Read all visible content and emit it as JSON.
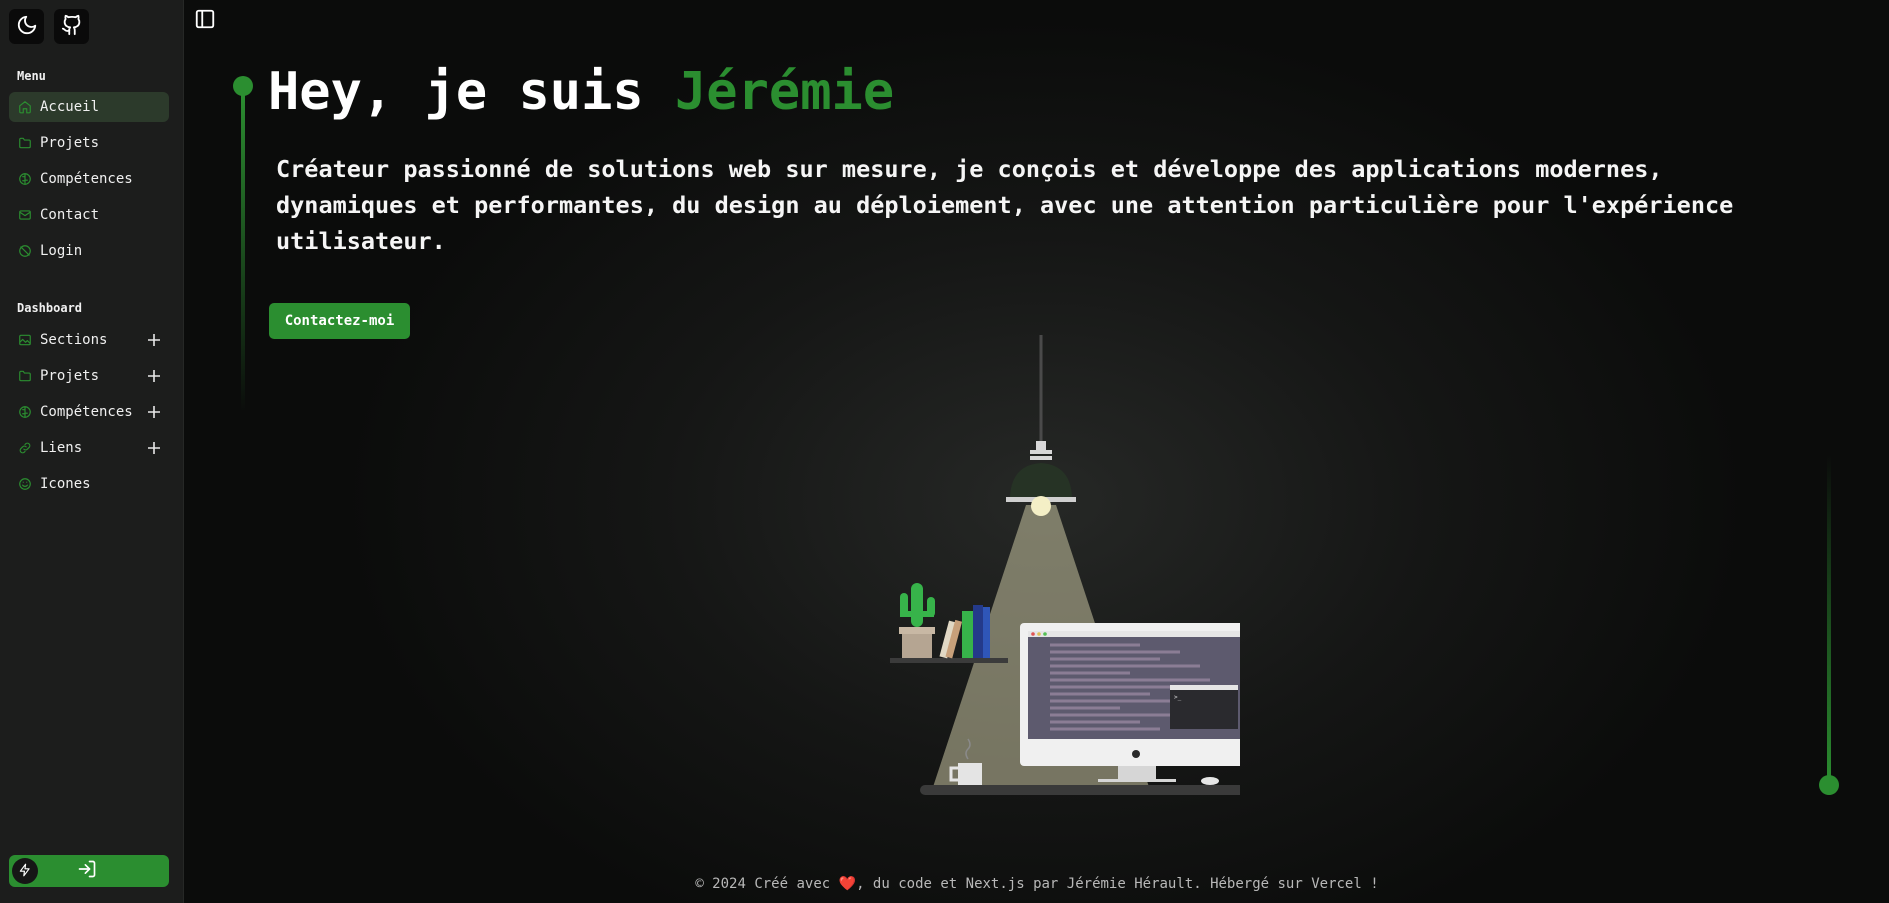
{
  "sidebar": {
    "menu_title": "Menu",
    "menu_items": [
      {
        "label": "Accueil",
        "icon": "home-icon",
        "active": true
      },
      {
        "label": "Projets",
        "icon": "folder-icon"
      },
      {
        "label": "Compétences",
        "icon": "brain-icon"
      },
      {
        "label": "Contact",
        "icon": "mail-icon"
      },
      {
        "label": "Login",
        "icon": "login-icon"
      }
    ],
    "dashboard_title": "Dashboard",
    "dashboard_items": [
      {
        "label": "Sections",
        "icon": "image-icon"
      },
      {
        "label": "Projets",
        "icon": "folder-icon"
      },
      {
        "label": "Compétences",
        "icon": "brain-icon"
      },
      {
        "label": "Liens",
        "icon": "link-icon"
      },
      {
        "label": "Icones",
        "icon": "smile-icon"
      }
    ]
  },
  "hero": {
    "title_prefix": "Hey, je suis",
    "title_name": "Jérémie",
    "description": "Créateur passionné de solutions web sur mesure, je conçois et développe des applications modernes, dynamiques et performantes, du design au déploiement, avec une attention particulière pour l'expérience utilisateur.",
    "cta_label": "Contactez-moi"
  },
  "footer": {
    "before_heart": "© 2024 Créé avec",
    "heart": "❤️",
    "after_heart": ", du code et Next.js par Jérémie Hérault. Hébergé sur Vercel !"
  },
  "colors": {
    "accent": "#2b8e30",
    "sidebar_bg": "#1c1d1c",
    "active_item_bg": "#2c3a2b",
    "page_bg": "#0b0c0b"
  }
}
